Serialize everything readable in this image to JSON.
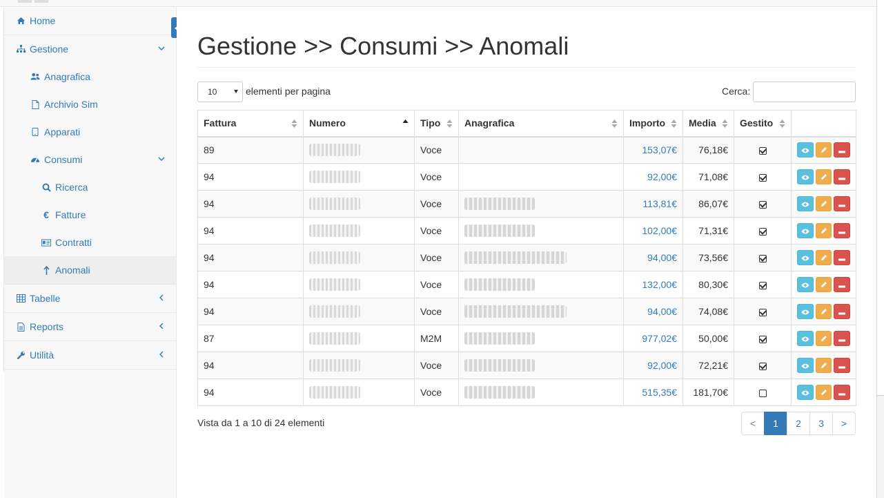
{
  "sidebar": {
    "items": [
      {
        "label": "Home",
        "icon": "home-icon"
      },
      {
        "label": "Gestione",
        "icon": "sitemap-icon"
      },
      {
        "label": "Anagrafica",
        "icon": "users-icon"
      },
      {
        "label": "Archivio Sim",
        "icon": "file-icon"
      },
      {
        "label": "Apparati",
        "icon": "tablet-icon"
      },
      {
        "label": "Consumi",
        "icon": "dashboard-icon"
      },
      {
        "label": "Ricerca",
        "icon": "search-icon"
      },
      {
        "label": "Fatture",
        "icon": "euro-icon"
      },
      {
        "label": "Contratti",
        "icon": "id-card-icon"
      },
      {
        "label": "Anomali",
        "icon": "arrow-up-icon"
      },
      {
        "label": "Tabelle",
        "icon": "table-icon"
      },
      {
        "label": "Reports",
        "icon": "file-text-icon"
      },
      {
        "label": "Utilità",
        "icon": "wrench-icon"
      }
    ],
    "active": "Anomali"
  },
  "page": {
    "title": "Gestione >> Consumi >> Anomali"
  },
  "controls": {
    "page_length": "10",
    "page_length_label": "elementi per pagina",
    "search_label": "Cerca:",
    "search_value": ""
  },
  "table": {
    "columns": [
      "Fattura",
      "Numero",
      "Tipo",
      "Anagrafica",
      "Importo",
      "Media",
      "Gestito"
    ],
    "rows": [
      {
        "fattura": "89",
        "tipo": "Voce",
        "anagrafica_blurred": false,
        "importo": "153,07€",
        "media": "76,18€",
        "gestito": true
      },
      {
        "fattura": "94",
        "tipo": "Voce",
        "anagrafica_blurred": false,
        "importo": "92,00€",
        "media": "71,08€",
        "gestito": true
      },
      {
        "fattura": "94",
        "tipo": "Voce",
        "anagrafica_blurred": true,
        "importo": "113,81€",
        "media": "86,07€",
        "gestito": true
      },
      {
        "fattura": "94",
        "tipo": "Voce",
        "anagrafica_blurred": true,
        "importo": "102,00€",
        "media": "71,31€",
        "gestito": true
      },
      {
        "fattura": "94",
        "tipo": "Voce",
        "anagrafica_blurred": true,
        "importo": "94,00€",
        "media": "73,56€",
        "gestito": true
      },
      {
        "fattura": "94",
        "tipo": "Voce",
        "anagrafica_blurred": true,
        "importo": "132,00€",
        "media": "80,30€",
        "gestito": true
      },
      {
        "fattura": "94",
        "tipo": "Voce",
        "anagrafica_blurred": true,
        "importo": "94,00€",
        "media": "74,08€",
        "gestito": true
      },
      {
        "fattura": "87",
        "tipo": "M2M",
        "anagrafica_blurred": true,
        "importo": "977,02€",
        "media": "50,00€",
        "gestito": true
      },
      {
        "fattura": "94",
        "tipo": "Voce",
        "anagrafica_blurred": true,
        "importo": "92,00€",
        "media": "72,21€",
        "gestito": true
      },
      {
        "fattura": "94",
        "tipo": "Voce",
        "anagrafica_blurred": true,
        "importo": "515,35€",
        "media": "181,70€",
        "gestito": false
      }
    ]
  },
  "footer": {
    "info": "Vista da 1 a 10 di 24 elementi",
    "pager": [
      "<",
      "1",
      "2",
      "3",
      ">"
    ],
    "current_page": "1"
  },
  "colors": {
    "link": "#337ab7",
    "view_button": "#5bc0de",
    "edit_button": "#f0ad4e",
    "delete_button": "#d9534f"
  }
}
